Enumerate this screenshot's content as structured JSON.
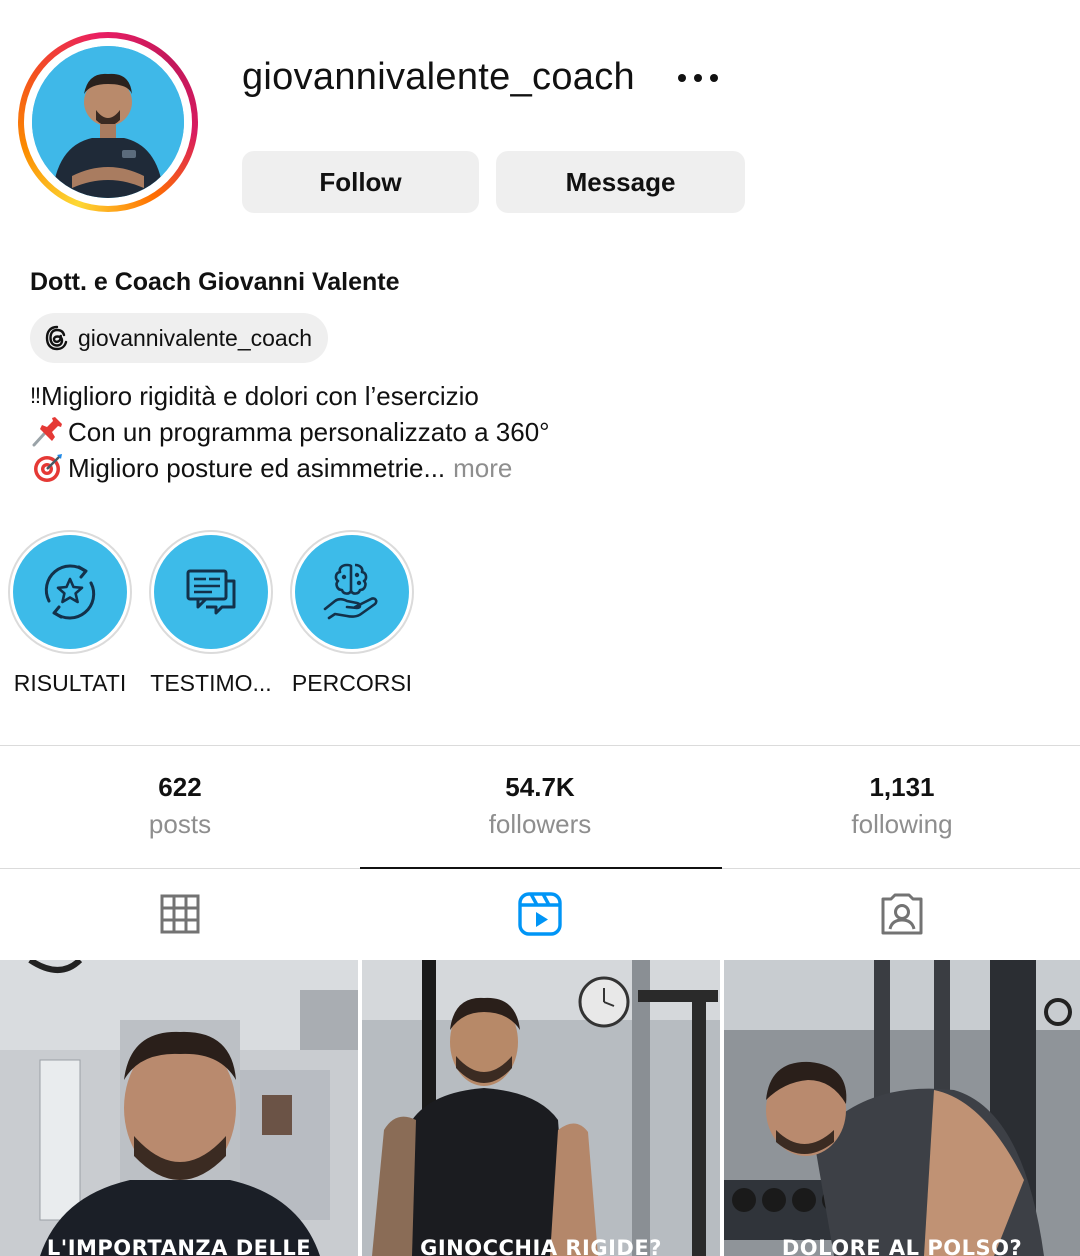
{
  "profile": {
    "username": "giovannivalente_coach",
    "full_name": "Dott. e Coach Giovanni Valente",
    "threads_handle": "giovannivalente_coach",
    "bio_lines": [
      {
        "emoji": "‼",
        "text": "Miglioro rigidità e dolori con l’esercizio"
      },
      {
        "emoji": "📌",
        "text": "Con un programma personalizzato a 360°"
      },
      {
        "emoji": "🎯",
        "text": "Miglioro posture ed asimmetrie..."
      }
    ],
    "more_label": "more"
  },
  "actions": {
    "follow_label": "Follow",
    "message_label": "Message"
  },
  "highlights": [
    {
      "label": "RISULTATI",
      "icon": "star-refresh-icon"
    },
    {
      "label": "TESTIMO...",
      "icon": "chat-bubbles-icon"
    },
    {
      "label": "PERCORSI",
      "icon": "brain-hand-icon"
    }
  ],
  "stats": [
    {
      "value": "622",
      "label": "posts"
    },
    {
      "value": "54.7K",
      "label": "followers"
    },
    {
      "value": "1,131",
      "label": "following"
    }
  ],
  "tabs": [
    {
      "name": "posts-grid",
      "icon": "grid-icon",
      "active": false
    },
    {
      "name": "reels",
      "icon": "reels-icon",
      "active": true
    },
    {
      "name": "tagged",
      "icon": "tagged-icon",
      "active": false
    }
  ],
  "reels": [
    {
      "caption": "L'IMPORTANZA DELLE"
    },
    {
      "caption": "GINOCCHIA RIGIDE?"
    },
    {
      "caption": "DOLORE AL POLSO?"
    }
  ],
  "colors": {
    "highlight_bg": "#3dbbe9",
    "button_bg": "#efefef",
    "active_tab": "#0095f6",
    "muted_text": "#8e8e8e"
  }
}
